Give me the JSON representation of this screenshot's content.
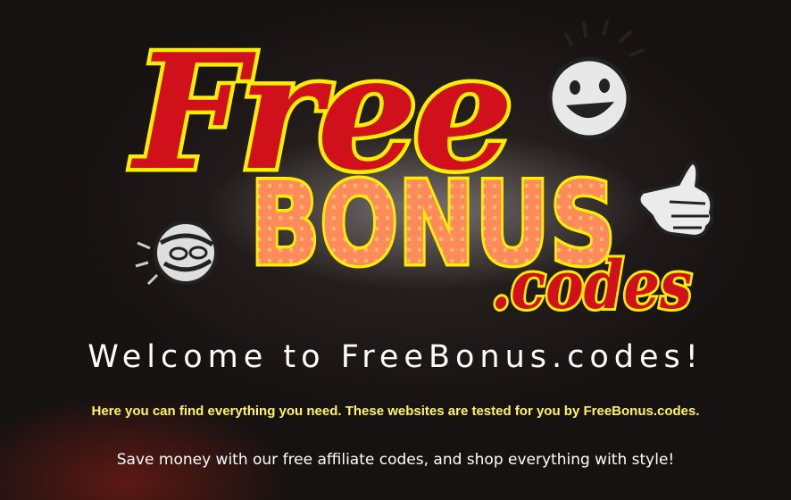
{
  "logo": {
    "word_free": "Free",
    "word_bonus": "BONUS",
    "word_codes": ".codes",
    "colors": {
      "red": "#d0101a",
      "yellow": "#ffee00",
      "pink": "#ff8a5c"
    },
    "icons": [
      "smiley-face-icon",
      "pointing-hand-icon",
      "ball-face-icon"
    ]
  },
  "hero": {
    "welcome": "Welcome to FreeBonus.codes!",
    "tagline": "Here you can find everything you need. These websites are tested for you by FreeBonus.codes.",
    "savings": "Save money with our free affiliate codes, and shop everything with style!"
  }
}
